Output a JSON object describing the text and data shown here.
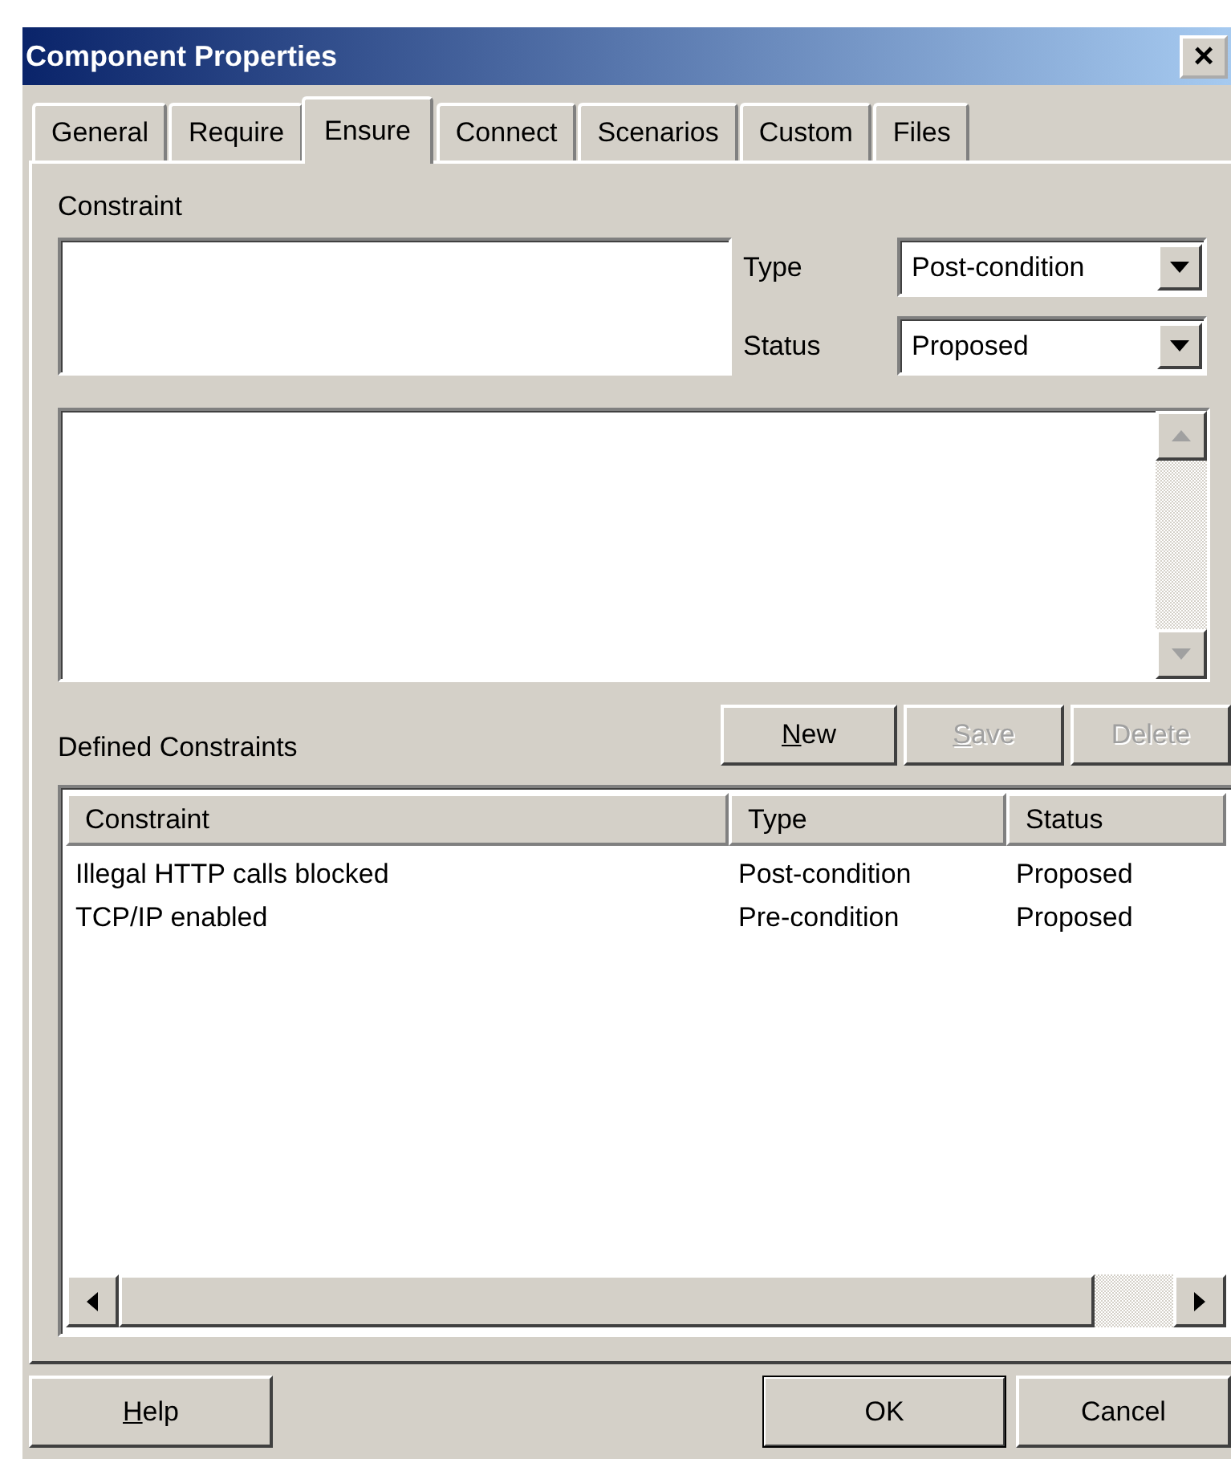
{
  "window": {
    "title": "Component Properties",
    "close": "×"
  },
  "tabs": [
    {
      "label": "General",
      "selected": false
    },
    {
      "label": "Require",
      "selected": false
    },
    {
      "label": "Ensure",
      "selected": true
    },
    {
      "label": "Connect",
      "selected": false
    },
    {
      "label": "Scenarios",
      "selected": false
    },
    {
      "label": "Custom",
      "selected": false
    },
    {
      "label": "Files",
      "selected": false
    }
  ],
  "constraint_label": "Constraint",
  "type": {
    "label": "Type",
    "value": "Post-condition"
  },
  "status": {
    "label": "Status",
    "value": "Proposed"
  },
  "defined_label": "Defined Constraints",
  "list_buttons": [
    {
      "label": "New",
      "underline_first": true,
      "disabled": false
    },
    {
      "label": "Save",
      "underline_first": true,
      "disabled": true
    },
    {
      "label": "Delete",
      "underline_first": false,
      "disabled": true
    }
  ],
  "table": {
    "columns": [
      "Constraint",
      "Type",
      "Status"
    ],
    "rows": [
      [
        "Illegal HTTP calls blocked",
        "Post-condition",
        "Proposed"
      ],
      [
        "TCP/IP enabled",
        "Pre-condition",
        "Proposed"
      ]
    ]
  },
  "buttons": [
    {
      "label": "Help",
      "underline_first": true,
      "default": false
    },
    {
      "label": "OK",
      "underline_first": false,
      "default": true
    },
    {
      "label": "Cancel",
      "underline_first": false,
      "default": false
    }
  ]
}
